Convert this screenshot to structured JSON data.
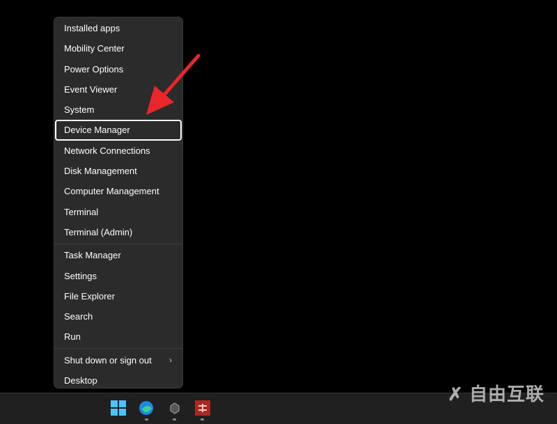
{
  "menu": {
    "groups": [
      [
        {
          "label": "Installed apps"
        },
        {
          "label": "Mobility Center"
        },
        {
          "label": "Power Options"
        },
        {
          "label": "Event Viewer"
        },
        {
          "label": "System"
        },
        {
          "label": "Device Manager",
          "focused": true
        },
        {
          "label": "Network Connections"
        },
        {
          "label": "Disk Management"
        },
        {
          "label": "Computer Management"
        },
        {
          "label": "Terminal"
        },
        {
          "label": "Terminal (Admin)"
        }
      ],
      [
        {
          "label": "Task Manager"
        },
        {
          "label": "Settings"
        },
        {
          "label": "File Explorer"
        },
        {
          "label": "Search"
        },
        {
          "label": "Run"
        }
      ],
      [
        {
          "label": "Shut down or sign out",
          "submenu": true
        },
        {
          "label": "Desktop"
        }
      ]
    ],
    "submenu_glyph": "›"
  },
  "annotation": {
    "arrow_color": "#e8262c"
  },
  "taskbar": {
    "icons": [
      "windows-start-icon",
      "edge-icon",
      "app-icon",
      "app-red-icon"
    ]
  },
  "watermark": {
    "text": "自由互联"
  }
}
